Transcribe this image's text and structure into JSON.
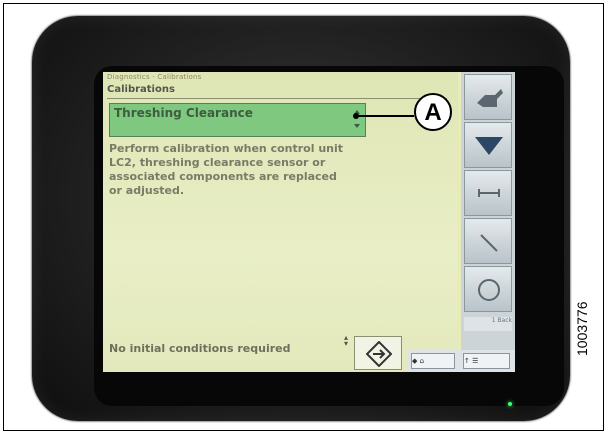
{
  "screen": {
    "breadcrumb": "Diagnostics - Calibrations",
    "title": "Calibrations",
    "dropdown": {
      "value": "Threshing Clearance"
    },
    "instructions": "Perform calibration when control unit\nLC2, threshing clearance sensor or\nassociated components are replaced\nor adjusted.",
    "conditions": "No initial conditions required",
    "sidebar": {
      "buttons": [
        {
          "icon": "pointer-hand-icon"
        },
        {
          "icon": "arrow-down-icon"
        },
        {
          "icon": "bracket-icon"
        },
        {
          "icon": "wrench-icon"
        },
        {
          "icon": "circle-icon"
        }
      ],
      "label": "1 Back"
    },
    "bottom": {
      "home_label": "◆ ⌂",
      "updown_label": "↑ ☰"
    }
  },
  "callout": {
    "label": "A"
  },
  "figure_id": "1003776"
}
